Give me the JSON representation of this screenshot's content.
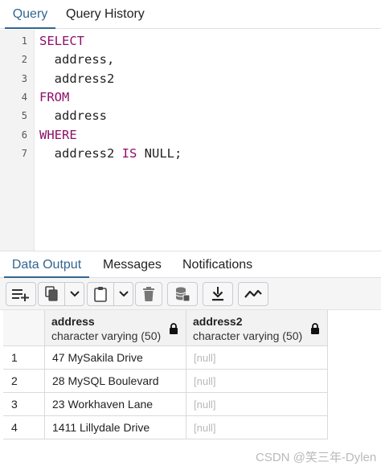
{
  "query_tabs": [
    "Query",
    "Query History"
  ],
  "editor": {
    "lines": [
      {
        "n": "1",
        "parts": [
          {
            "t": "SELECT",
            "k": true
          }
        ]
      },
      {
        "n": "2",
        "parts": [
          {
            "t": "  address,",
            "k": false
          }
        ]
      },
      {
        "n": "3",
        "parts": [
          {
            "t": "  address2",
            "k": false
          }
        ]
      },
      {
        "n": "4",
        "parts": [
          {
            "t": "FROM",
            "k": true
          }
        ]
      },
      {
        "n": "5",
        "parts": [
          {
            "t": "  address",
            "k": false
          }
        ]
      },
      {
        "n": "6",
        "parts": [
          {
            "t": "WHERE",
            "k": true
          }
        ]
      },
      {
        "n": "7",
        "parts": [
          {
            "t": "  address2 ",
            "k": false
          },
          {
            "t": "IS",
            "k": true
          },
          {
            "t": " NULL;",
            "k": false
          }
        ]
      }
    ]
  },
  "output_tabs": [
    "Data Output",
    "Messages",
    "Notifications"
  ],
  "toolbar_icons": [
    "add-row-icon",
    "copy-icon",
    "chevron-down-icon",
    "paste-icon",
    "chevron-down-icon",
    "delete-icon",
    "save-data-icon",
    "download-icon",
    "graph-icon"
  ],
  "grid": {
    "columns": [
      {
        "name": "address",
        "type": "character varying (50)"
      },
      {
        "name": "address2",
        "type": "character varying (50)"
      }
    ],
    "rows": [
      {
        "num": "1",
        "address": "47 MySakila Drive",
        "address2": "[null]"
      },
      {
        "num": "2",
        "address": "28 MySQL Boulevard",
        "address2": "[null]"
      },
      {
        "num": "3",
        "address": "23 Workhaven Lane",
        "address2": "[null]"
      },
      {
        "num": "4",
        "address": "1411 Lillydale Drive",
        "address2": "[null]"
      }
    ]
  },
  "watermark": "CSDN @笑三年-Dylen",
  "colors": {
    "accent": "#326690",
    "keyword": "#8e0f6a",
    "null_text": "#b8b8b8"
  }
}
